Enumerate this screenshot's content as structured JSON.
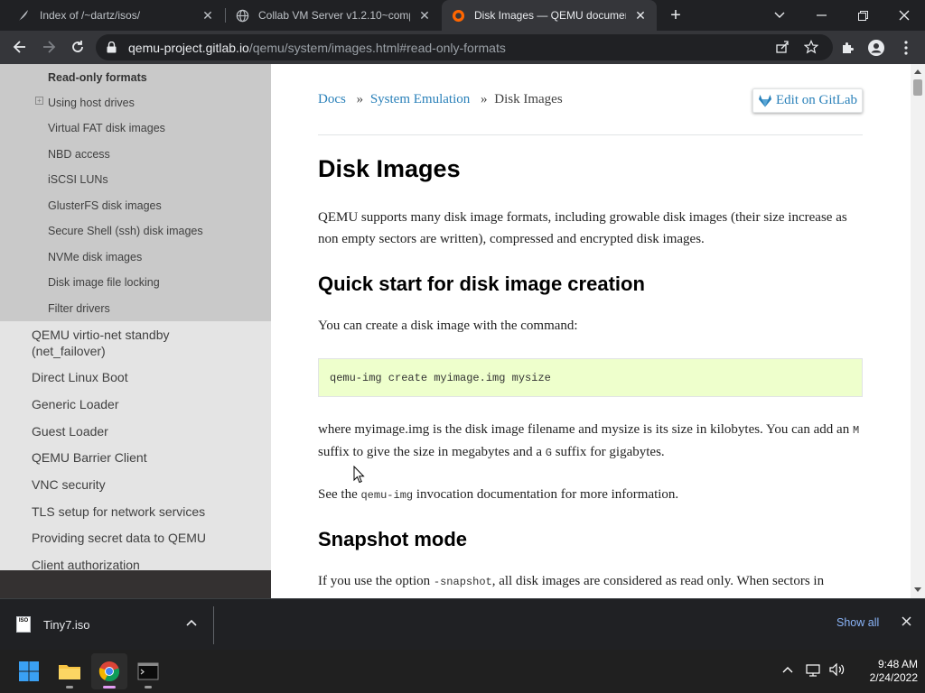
{
  "browser": {
    "tabs": [
      {
        "title": "Index of /~dartz/isos/",
        "favicon": "apache-feather-icon",
        "active": false
      },
      {
        "title": "Collab VM Server v1.2.10~compu",
        "favicon": "globe-icon",
        "active": false
      },
      {
        "title": "Disk Images — QEMU document",
        "favicon": "qemu-icon",
        "active": true
      }
    ],
    "url_host": "qemu-project.gitlab.io",
    "url_path": "/qemu/system/images.html#read-only-formats"
  },
  "sidebar": {
    "subitems": [
      {
        "label": "Read-only formats",
        "current": true
      },
      {
        "label": "Using host drives",
        "expandable": true
      },
      {
        "label": "Virtual FAT disk images"
      },
      {
        "label": "NBD access"
      },
      {
        "label": "iSCSI LUNs"
      },
      {
        "label": "GlusterFS disk images"
      },
      {
        "label": "Secure Shell (ssh) disk images"
      },
      {
        "label": "NVMe disk images"
      },
      {
        "label": "Disk image file locking"
      },
      {
        "label": "Filter drivers"
      }
    ],
    "items": [
      {
        "label_line1": "QEMU virtio-net standby",
        "label_line2": "(net_failover)"
      },
      {
        "label": "Direct Linux Boot"
      },
      {
        "label": "Generic Loader"
      },
      {
        "label": "Guest Loader"
      },
      {
        "label": "QEMU Barrier Client"
      },
      {
        "label": "VNC security"
      },
      {
        "label": "TLS setup for network services"
      },
      {
        "label": "Providing secret data to QEMU"
      },
      {
        "label": "Client authorization"
      }
    ]
  },
  "content": {
    "breadcrumb": {
      "docs": "Docs",
      "sep": "»",
      "system": "System Emulation",
      "current": "Disk Images"
    },
    "edit_button": "Edit on GitLab",
    "title": "Disk Images",
    "intro": "QEMU supports many disk image formats, including growable disk images (their size increase as non empty sectors are written), compressed and encrypted disk images.",
    "h_quickstart": "Quick start for disk image creation",
    "p_create": "You can create a disk image with the command:",
    "code": "qemu-img create myimage.img mysize",
    "p_where_a": "where myimage.img is the disk image filename and mysize is its size in kilobytes. You can add an ",
    "p_where_m": "M",
    "p_where_b": " suffix to give the size in megabytes and a ",
    "p_where_g": "G",
    "p_where_c": " suffix for gigabytes.",
    "p_see_a": "See the ",
    "p_see_code": "qemu-img",
    "p_see_b": " invocation documentation for more information.",
    "h_snapshot": "Snapshot mode",
    "p_snap_a": "If you use the option ",
    "p_snap_code": "-snapshot",
    "p_snap_b": ", all disk images are considered as read only. When sectors in"
  },
  "downloads": {
    "file": "Tiny7.iso",
    "icon_text": "ISO",
    "show_all": "Show all"
  },
  "taskbar": {
    "time": "9:48 AM",
    "date": "2/24/2022"
  },
  "colors": {
    "link": "#2980b9",
    "code_bg": "#eeffcc",
    "sidebar_bg": "#e4e4e4",
    "sidebar_sub_bg": "#c9c9c9",
    "chrome_dark": "#202124",
    "chrome_toolbar": "#35363a"
  }
}
